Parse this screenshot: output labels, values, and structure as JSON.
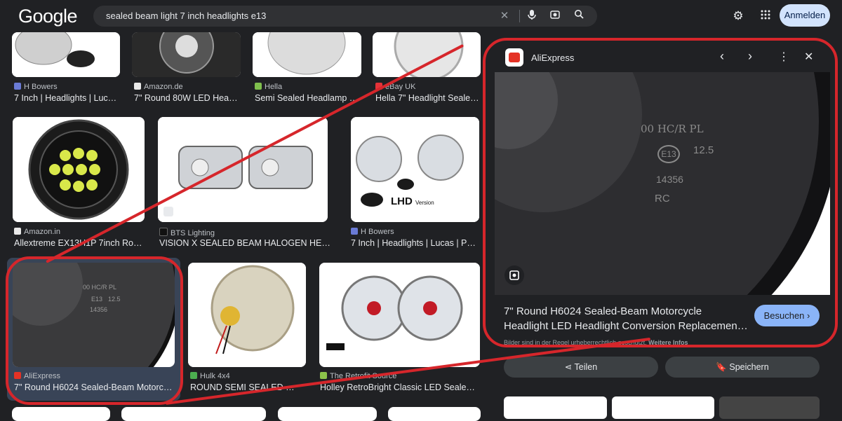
{
  "header": {
    "logo": "Google",
    "search_query": "sealed beam light 7 inch headlights e13",
    "signin_label": "Anmelden"
  },
  "results": [
    {
      "source": "H Bowers",
      "title": "7 Inch | Headlights | Luca…"
    },
    {
      "source": "Amazon.de",
      "title": "7\" Round 80W LED Head…"
    },
    {
      "source": "Hella",
      "title": "Semi Sealed Headlamp I…"
    },
    {
      "source": "eBay UK",
      "title": "Hella 7\" Headlight Seale…"
    },
    {
      "source": "Amazon.in",
      "title": "Allextreme EX13H1P 7inch Rou…"
    },
    {
      "source": "BTS Lighting",
      "title": "VISION X SEALED BEAM HALOGEN HEAD…"
    },
    {
      "source": "H Bowers",
      "title": "7 Inch | Headlights | Lucas | P7…"
    },
    {
      "source": "AliExpress",
      "title": "7\" Round H6024 Sealed-Beam Motorcy…"
    },
    {
      "source": "Hulk 4x4",
      "title": "ROUND SEMI SEALED BE…"
    },
    {
      "source": "The Retrofit Source",
      "title": "Holley RetroBright Classic LED Sealed …"
    }
  ],
  "images": {
    "lhd_text": "LHD",
    "lhd_sub": "Version",
    "lens_markings": [
      "00 HC/R PL",
      "E13",
      "12.5",
      "14356",
      "RC"
    ]
  },
  "panel": {
    "source": "AliExpress",
    "title_line1": "7\" Round H6024 Sealed-Beam Motorcycle",
    "title_line2": "Headlight LED Headlight Conversion Replacemen…",
    "visit_label": "Besuchen",
    "copyright_note": "Bilder sind in der Regel urheberrechtlich geschützt.",
    "more_info": "Weitere Infos",
    "share_label": "Teilen",
    "save_label": "Speichern"
  },
  "colors": {
    "background": "#202124",
    "annotation_red": "#d6262b",
    "accent_blue": "#8ab4f8",
    "aliexpress_orange": "#e43225"
  }
}
